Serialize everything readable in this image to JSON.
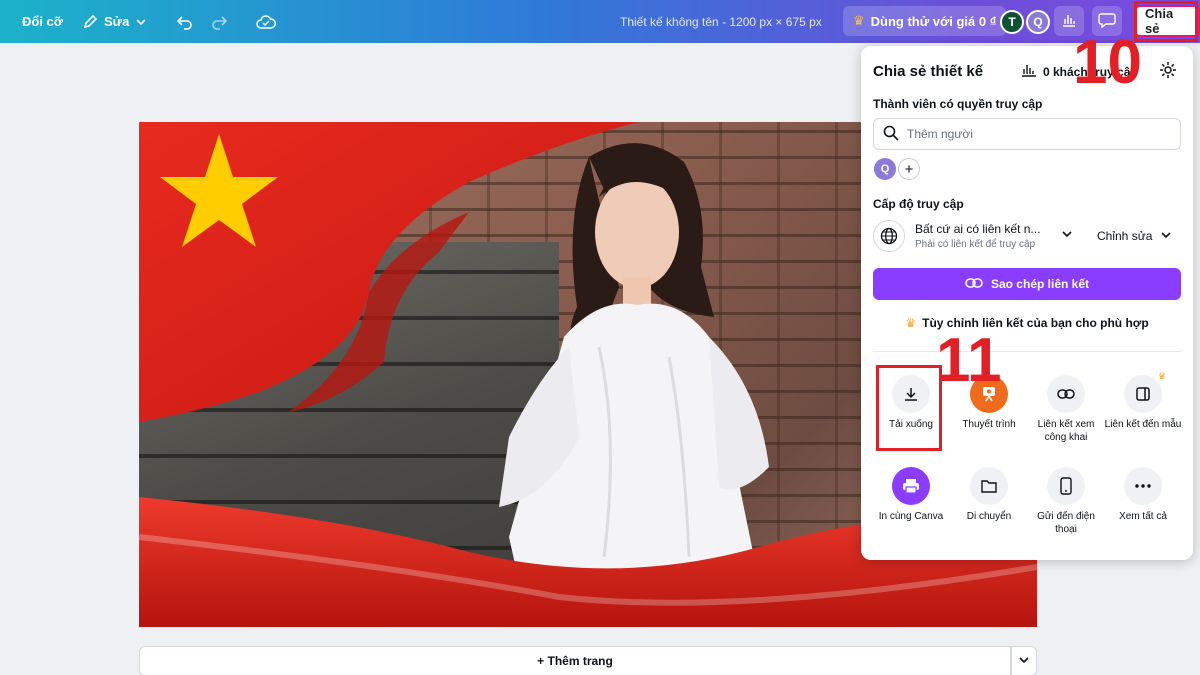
{
  "topbar": {
    "resize_label": "Đổi cỡ",
    "edit_label": "Sửa",
    "doc_title": "Thiết kế không tên - 1200 px × 675 px",
    "trial_label": "Dùng thử với giá 0 ₫",
    "avatars": [
      "T",
      "Q"
    ],
    "share_label": "Chia sẻ"
  },
  "canvas": {
    "add_page_label": "+ Thêm trang"
  },
  "share_panel": {
    "title": "Chia sẻ thiết kế",
    "visitors_label": "0 khách truy cập",
    "members_heading": "Thành viên có quyền truy cập",
    "search_placeholder": "Thêm người",
    "member_initial": "Q",
    "access_heading": "Cấp độ truy cập",
    "access_main": "Bất cứ ai có liên kết n...",
    "access_sub": "Phải có liên kết để truy cập",
    "role_label": "Chỉnh sửa",
    "copy_link_label": "Sao chép liên kết",
    "customize_label": "Tùy chỉnh liên kết của bạn cho phù hợp",
    "actions": [
      {
        "label": "Tải xuống",
        "icon": "download-icon"
      },
      {
        "label": "Thuyết trình",
        "icon": "present-icon"
      },
      {
        "label": "Liên kết xem công khai",
        "icon": "link-icon"
      },
      {
        "label": "Liên kết đến mẫu",
        "icon": "template-icon"
      },
      {
        "label": "In cùng Canva",
        "icon": "print-icon"
      },
      {
        "label": "Di chuyển",
        "icon": "folder-icon"
      },
      {
        "label": "Gửi đến điện thoại",
        "icon": "phone-icon"
      },
      {
        "label": "Xem tất cả",
        "icon": "more-icon"
      }
    ]
  },
  "annotations": {
    "step_10": "10",
    "step_11": "11"
  },
  "colors": {
    "accent_purple": "#8b3dff",
    "annotation_red": "#e31e24",
    "flag_red": "#da251d",
    "flag_star": "#ffcd00"
  }
}
